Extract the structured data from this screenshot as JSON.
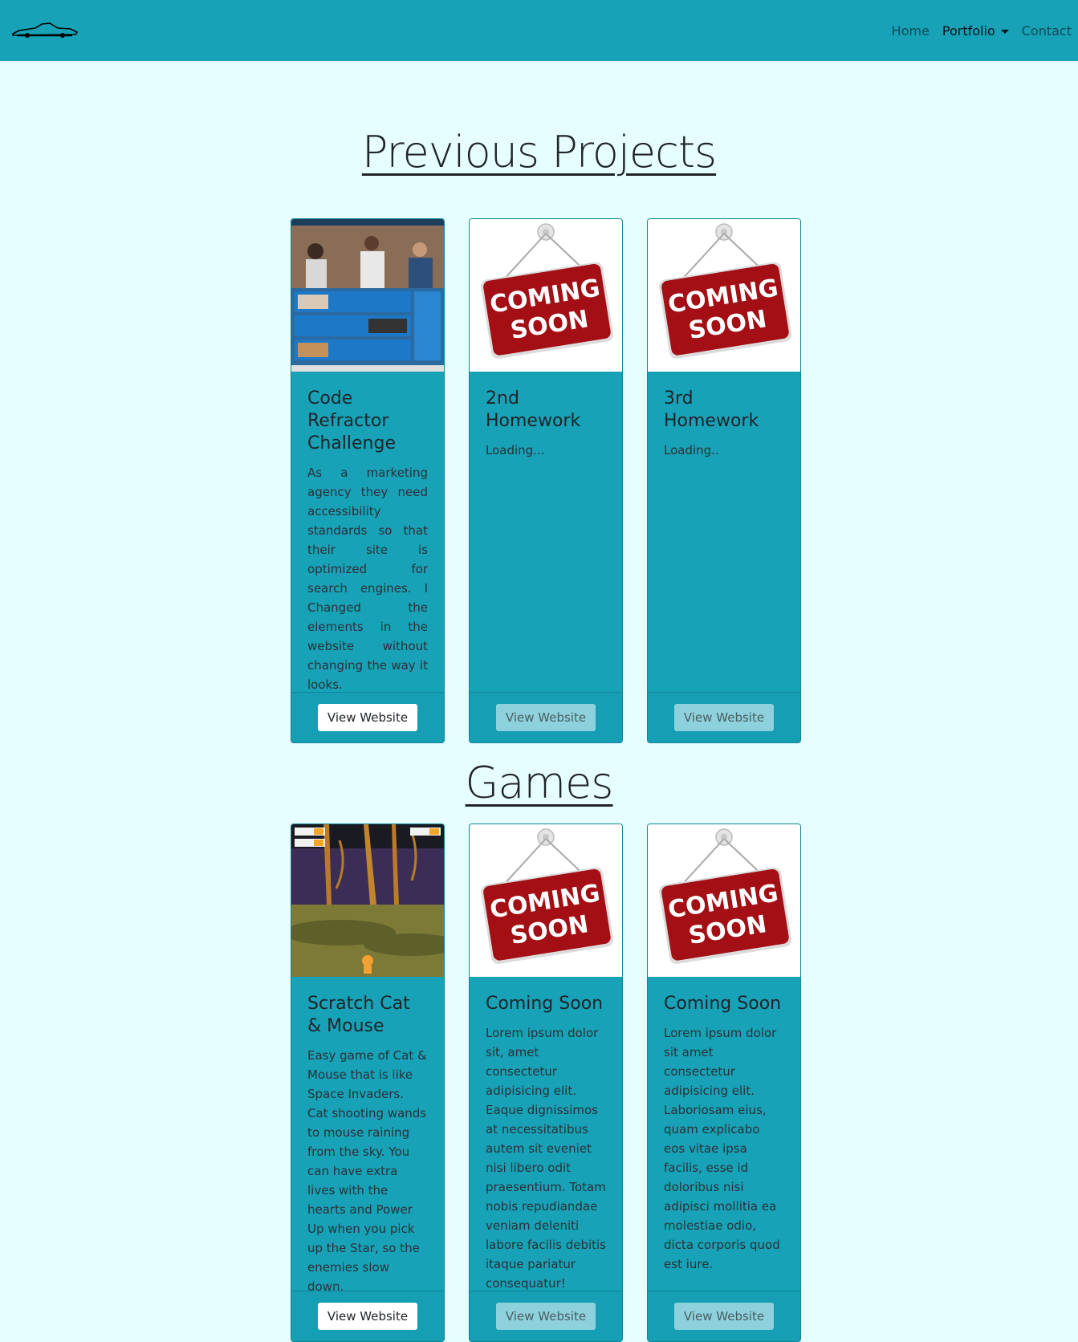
{
  "nav": {
    "brand_icon": "car-logo-icon",
    "links": [
      {
        "label": "Home"
      },
      {
        "label": "Portfolio"
      },
      {
        "label": "Contact"
      }
    ]
  },
  "sections": [
    {
      "title": "Previous Projects",
      "cards": [
        {
          "title": "Code Refractor Challenge",
          "text": "As a marketing agency they need accessibility standards so that their site is optimized for search engines. I Changed the elements in the website without changing the way it looks.",
          "button": "View Website",
          "image": "website-screenshot"
        },
        {
          "title": "2nd Homework",
          "text": "Loading...",
          "button": "View Website",
          "image": "coming-soon-sign"
        },
        {
          "title": "3rd Homework",
          "text": "Loading..",
          "button": "View Website",
          "image": "coming-soon-sign"
        }
      ]
    },
    {
      "title": "Games",
      "cards": [
        {
          "title": "Scratch Cat & Mouse",
          "text": "Easy game of Cat & Mouse that is like Space Invaders. Cat shooting wands to mouse raining from the sky. You can have extra lives with the hearts and Power Up when you pick up the Star, so the enemies slow down.",
          "button": "View Website",
          "image": "game-screenshot"
        },
        {
          "title": "Coming Soon",
          "text": "Lorem ipsum dolor sit, amet consectetur adipisicing elit. Eaque dignissimos at necessitatibus autem sit eveniet nisi libero odit praesentium. Totam nobis repudiandae veniam deleniti labore facilis debitis itaque pariatur consequatur!",
          "button": "View Website",
          "image": "coming-soon-sign"
        },
        {
          "title": "Coming Soon",
          "text": "Lorem ipsum dolor sit amet consectetur adipisicing elit. Laboriosam eius, quam explicabo eos vitae ipsa facilis, esse id doloribus nisi adipisci mollitia ea molestiae odio, dicta corporis quod est iure.",
          "button": "View Website",
          "image": "coming-soon-sign"
        }
      ]
    }
  ],
  "sign": {
    "line1": "COMING",
    "line2": "SOON"
  },
  "colors": {
    "navbar": "#17a2b8",
    "background": "#e6feff",
    "card": "#17a2b8",
    "sign_red": "#a30f14"
  }
}
